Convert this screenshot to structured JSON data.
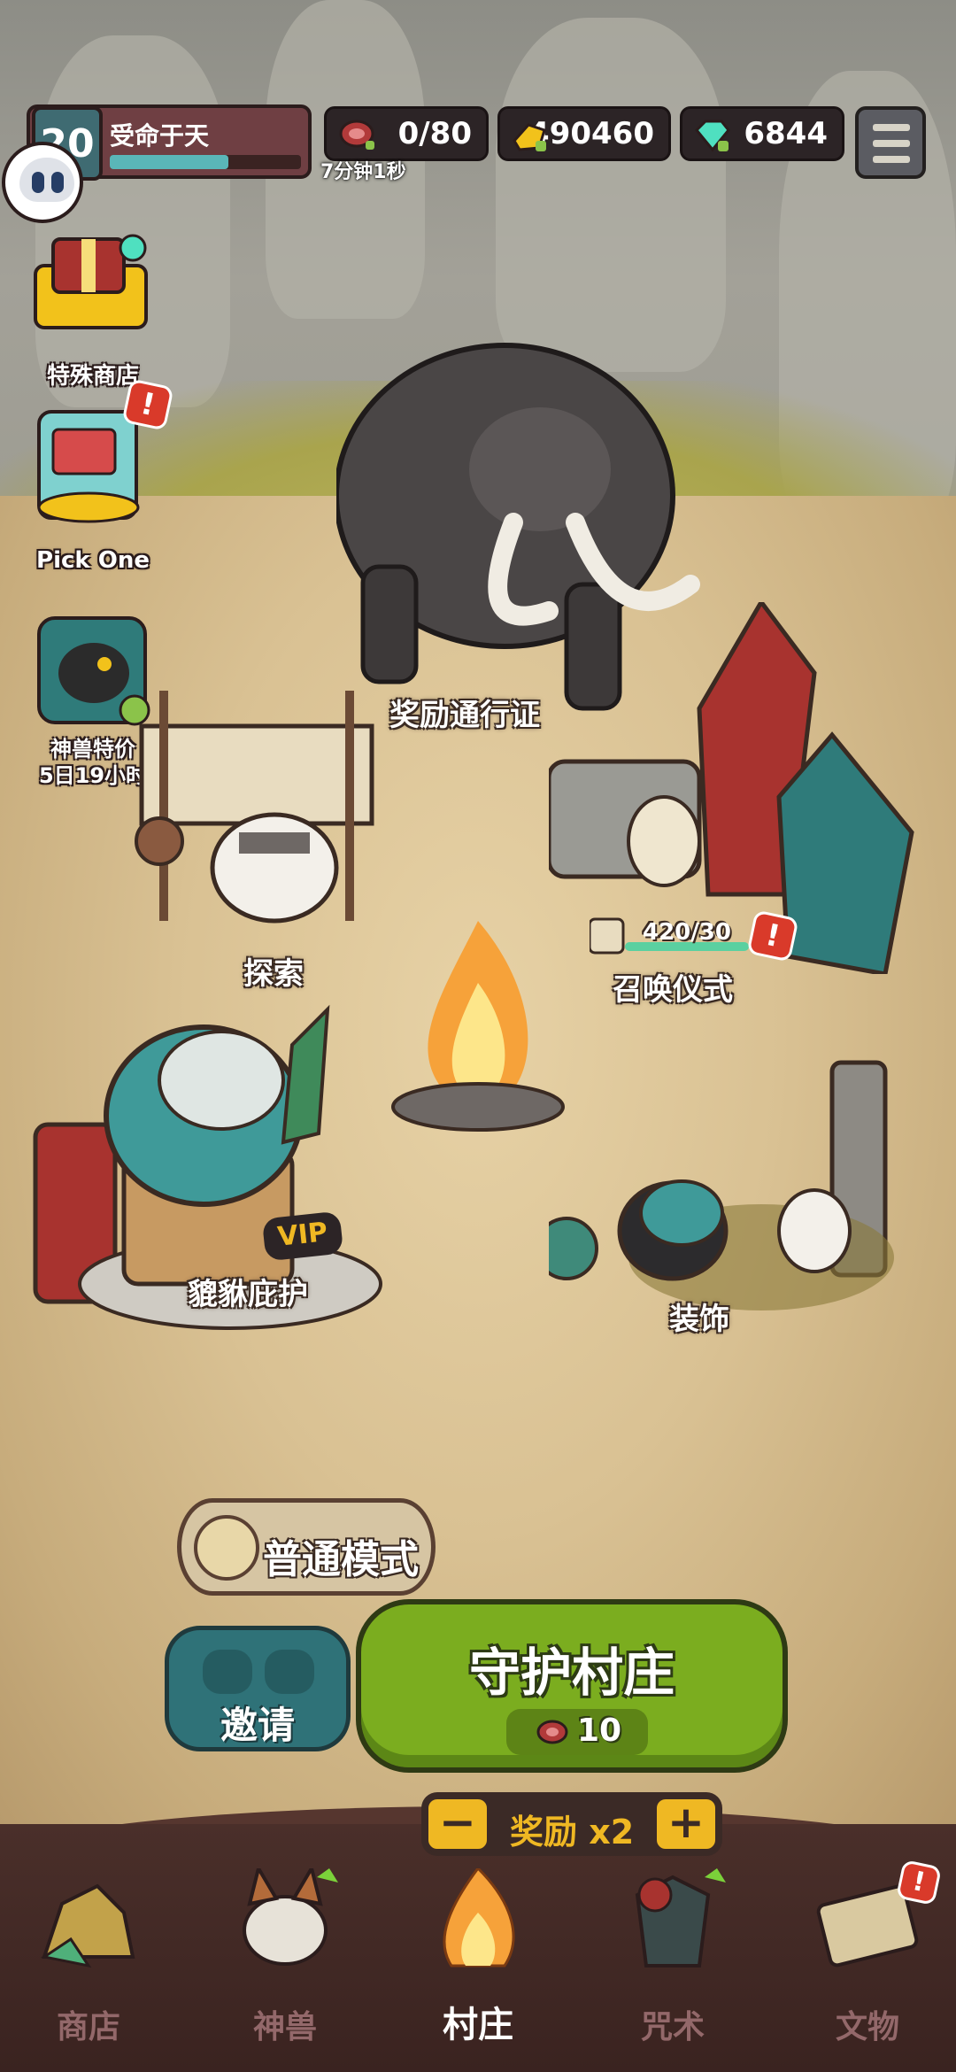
{
  "player": {
    "level": "20",
    "name": "受命于天",
    "xp_fraction": 0.62
  },
  "resources": {
    "meat": "0/80",
    "meat_timer": "7分钟1秒",
    "gold": "490460",
    "gems": "6844"
  },
  "side_buttons": {
    "special_shop": "特殊商店",
    "pick_one": "Pick One",
    "beast_deal_title": "神兽特价",
    "beast_deal_timer": "5日19小时",
    "alert_mark": "!"
  },
  "buildings": {
    "battle_pass": "奖励通行证",
    "explore": "探索",
    "summon": "召唤仪式",
    "summon_progress": "420/30",
    "guardian": "貔貅庇护",
    "vip_badge": "VIP",
    "decoration": "装饰"
  },
  "actions": {
    "mode": "普通模式",
    "invite": "邀请",
    "defend": "守护村庄",
    "defend_cost": "10",
    "reward_minus": "−",
    "reward_plus": "+",
    "reward_label": "奖励 x2"
  },
  "nav": {
    "shop": "商店",
    "beasts": "神兽",
    "village": "村庄",
    "spells": "咒术",
    "relics": "文物",
    "active": "village"
  },
  "colors": {
    "defend_button": "#7bad1f",
    "invite_button": "#2f7278",
    "alert_badge": "#d93a2a",
    "nav_inactive": "#93686a"
  }
}
